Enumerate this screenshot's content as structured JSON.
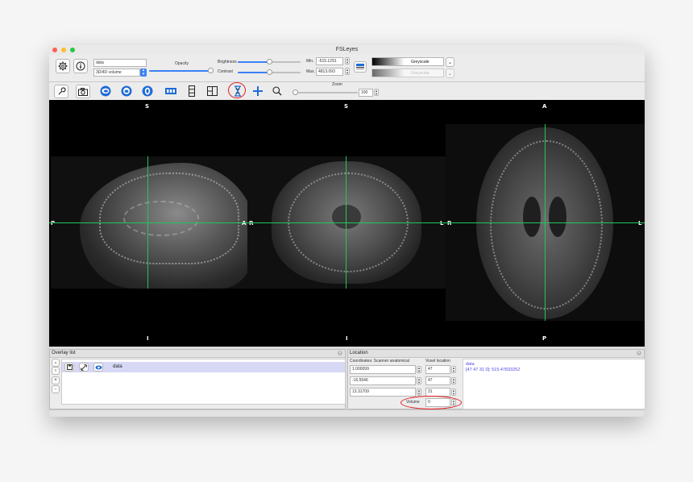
{
  "window": {
    "title": "FSLeyes",
    "traffic": {
      "close": "#fe5f57",
      "minimize": "#febc2e",
      "maximize": "#28c840"
    }
  },
  "toolbar": {
    "overlay_name": "data",
    "volume_option": "3D/4D volume",
    "opacity_label": "Opacity",
    "brightness_label": "Brightness",
    "contrast_label": "Contrast",
    "min_label": "Min.",
    "min_value": "-515.1291",
    "max_label": "Max.",
    "max_value": "4813.093",
    "colormap": "Greyscale",
    "colormap2": "Greyscale",
    "zoom_label": "Zoom",
    "zoom_value": "100"
  },
  "sliders": {
    "opacity": 1.0,
    "brightness": 0.5,
    "contrast": 0.5,
    "zoom": 0.0
  },
  "icons": {
    "settings": "gear-icon",
    "info": "info-icon",
    "tools": [
      "wrench-icon",
      "camera-icon",
      "sagittal-icon",
      "coronal-icon",
      "axial-icon",
      "layout-horizontal-icon",
      "layout-vertical-icon",
      "layout-grid-icon",
      "movie-icon",
      "crosshair-icon",
      "zoom-icon"
    ]
  },
  "canvas": {
    "sagittal": {
      "top": "S",
      "bottom": "I",
      "left": "P",
      "right": "A"
    },
    "coronal": {
      "top": "S",
      "bottom": "I",
      "left": "R",
      "right": "L"
    },
    "axial": {
      "top": "A",
      "bottom": "P",
      "left": "R",
      "right": "L"
    },
    "cursor_color": "#22c55e"
  },
  "overlay_list": {
    "title": "Overlay list",
    "items": [
      {
        "name": "data"
      }
    ]
  },
  "location": {
    "title": "Location",
    "coords_header": "Coordinates: Scanner anatomical",
    "voxel_header": "Voxel location",
    "coords": [
      "1.000099",
      "-16.5546",
      "13.31709"
    ],
    "voxels": [
      "47",
      "47",
      "31"
    ],
    "volume_label": "Volume",
    "volume_value": "0",
    "info_name": "data",
    "info_value": "[47 47 31 0]: 515.47833252"
  },
  "highlight_color": "#e02020"
}
